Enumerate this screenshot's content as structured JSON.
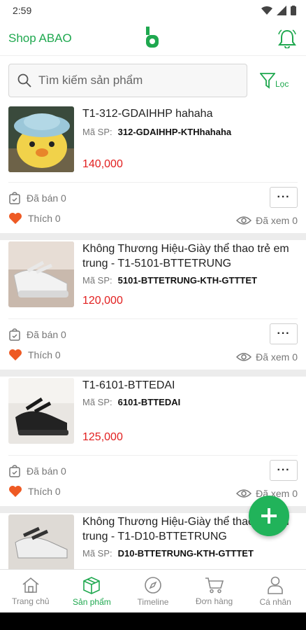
{
  "status": {
    "time": "2:59"
  },
  "header": {
    "shop_name": "Shop ABAO"
  },
  "search": {
    "placeholder": "Tìm kiếm sản phẩm",
    "filter_label": "Lọc"
  },
  "colors": {
    "brand_green": "#1fa84f",
    "price_red": "#e21f1f",
    "fab": "#21b35a"
  },
  "products": [
    {
      "name": "T1-312-GDAIHHP hahaha",
      "sku_label": "Mã SP:",
      "sku": "312-GDAIHHP-KTHhahaha",
      "price": "140,000",
      "sold": "Đã bán 0",
      "likes": "Thích 0",
      "views": "Đã xem 0",
      "more": "···"
    },
    {
      "name": "Không Thương Hiệu-Giày thể thao trẻ em trung - T1-5101-BTTETRUNG",
      "sku_label": "Mã SP:",
      "sku": "5101-BTTETRUNG-KTH-GTTTET",
      "price": "120,000",
      "sold": "Đã bán 0",
      "likes": "Thích 0",
      "views": "Đã xem 0",
      "more": "···"
    },
    {
      "name": "T1-6101-BTTEDAI",
      "sku_label": "Mã SP:",
      "sku": "6101-BTTEDAI",
      "price": "125,000",
      "sold": "Đã bán 0",
      "likes": "Thích 0",
      "views": "Đã xem 0",
      "more": "···"
    },
    {
      "name": "Không Thương Hiệu-Giày thể thao trẻ em trung - T1-D10-BTTETRUNG",
      "sku_label": "Mã SP:",
      "sku": "D10-BTTETRUNG-KTH-GTTTET"
    }
  ],
  "tabs": [
    {
      "label": "Trang chủ",
      "icon": "home-icon"
    },
    {
      "label": "Sản phẩm",
      "icon": "box-icon"
    },
    {
      "label": "Timeline",
      "icon": "compass-icon"
    },
    {
      "label": "Đơn hàng",
      "icon": "cart-icon"
    },
    {
      "label": "Cá nhân",
      "icon": "user-icon"
    }
  ]
}
